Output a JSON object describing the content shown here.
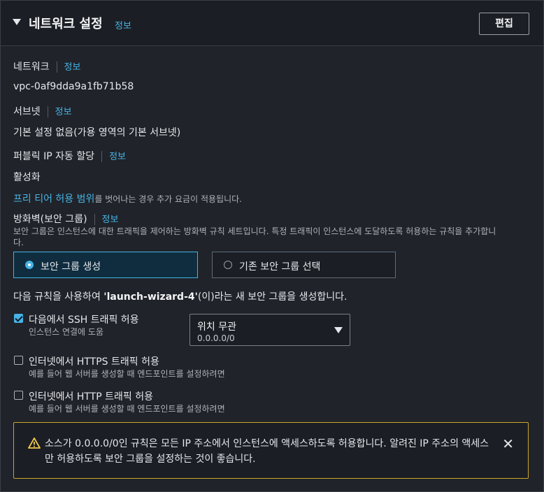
{
  "header": {
    "title": "네트워크 설정",
    "info": "정보",
    "edit_label": "편집"
  },
  "network": {
    "label": "네트워크",
    "info": "정보",
    "value": "vpc-0af9dda9a1fb71b58"
  },
  "subnet": {
    "label": "서브넷",
    "info": "정보",
    "value": "기본 설정 없음(가용 영역의 기본 서브넷)"
  },
  "public_ip": {
    "label": "퍼블릭 IP 자동 할당",
    "info": "정보",
    "value": "활성화"
  },
  "free_tier": {
    "link": "프리 티어 허용 범위",
    "text": "를 벗어나는 경우 추가 요금이 적용됩니다."
  },
  "firewall": {
    "label": "방화벽(보안 그룹)",
    "info": "정보",
    "description_line1": "보안 그룹은 인스턴스에 대한 트래픽을 제어하는 방화벽 규칙 세트입니다. 특정 트래픽이 인스턴스에 도달하도록 허용하는 규칙을 추가합니",
    "description_line2": "다.",
    "options": [
      {
        "label": "보안 그룹 생성",
        "selected": true
      },
      {
        "label": "기존 보안 그룹 선택",
        "selected": false
      }
    ],
    "rule_prefix": "다음 규칙을 사용하여 ",
    "rule_name": "'launch-wizard-4'",
    "rule_suffix": "(이)라는 새 보안 그룹을 생성합니다."
  },
  "rules": [
    {
      "label": "다음에서 SSH 트래픽 허용",
      "sub": "인스턴스 연결에 도움",
      "checked": true
    },
    {
      "label": "인터넷에서 HTTPS 트래픽 허용",
      "sub": "예를 들어 웹 서버를 생성할 때 엔드포인트를 설정하려면",
      "checked": false
    },
    {
      "label": "인터넷에서 HTTP 트래픽 허용",
      "sub": "예를 들어 웹 서버를 생성할 때 엔드포인트를 설정하려면",
      "checked": false
    }
  ],
  "ssh_source": {
    "value": "위치 무관",
    "sub": "0.0.0.0/0"
  },
  "alert": {
    "message": "소스가 0.0.0.0/0인 규칙은 모든 IP 주소에서 인스턴스에 액세스하도록 허용합니다. 알려진 IP 주소의 액세스만 허용하도록 보안 그룹을 설정하는 것이 좋습니다.",
    "close": "✕",
    "icon": "warning-icon"
  },
  "colors": {
    "accent": "#46b3e6",
    "warning": "#c8a72d",
    "background": "#202329"
  }
}
